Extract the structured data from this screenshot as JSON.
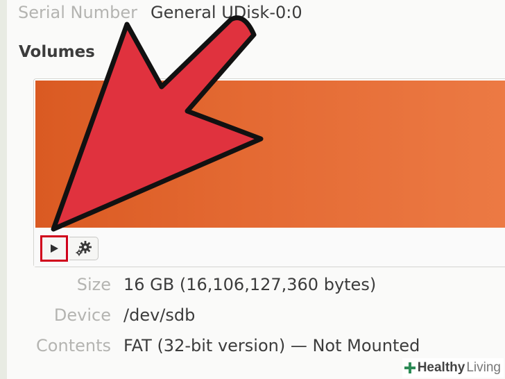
{
  "drive": {
    "serial_label": "Serial Number",
    "serial_value": "General UDisk-0:0"
  },
  "volumes": {
    "heading": "Volumes",
    "bar_color": "#e46a33",
    "toolbar": {
      "play_icon": "play-icon",
      "gear_icon": "gear-icon"
    }
  },
  "properties": [
    {
      "label": "Size",
      "value": "16 GB (16,106,127,360 bytes)"
    },
    {
      "label": "Device",
      "value": "/dev/sdb"
    },
    {
      "label": "Contents",
      "value": "FAT (32-bit version) — Not Mounted"
    }
  ],
  "annotation": {
    "arrow_color": "#e0323e",
    "highlight_color": "#d0001b"
  },
  "watermark": {
    "bold": "Healthy",
    "light": "Living"
  }
}
